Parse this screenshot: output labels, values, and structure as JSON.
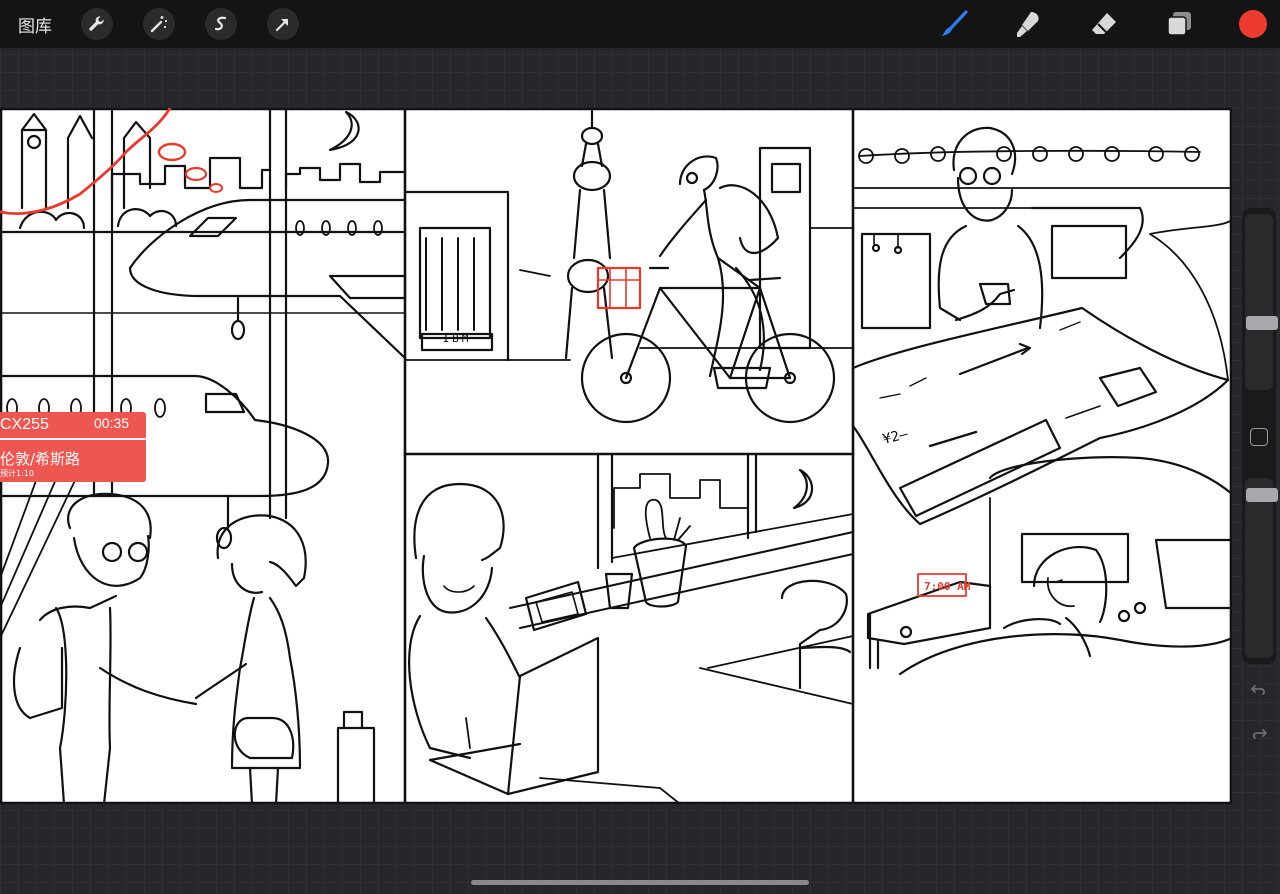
{
  "toolbar": {
    "gallery_label": "图库",
    "left_tools": [
      "wrench-icon",
      "magic-wand-icon",
      "selection-icon",
      "transform-arrow-icon"
    ],
    "right_tools": [
      "brush-icon",
      "smudge-icon",
      "eraser-icon",
      "layers-icon"
    ],
    "active_tool": "brush-icon",
    "current_color": "#ee3b30"
  },
  "artwork": {
    "flight_card": {
      "flight_number": "CX255",
      "time": "00:35",
      "destination": "伦敦/希斯路",
      "subtitle": "预计1:10"
    },
    "building_sign": "IBM",
    "alarm_clock": "7:00 AM",
    "check_mark": "¥2—"
  },
  "sidebar": {
    "brush_size_level": 0.63,
    "opacity_level": 0.06,
    "modify_button": "square-modify-icon",
    "undo": "undo-icon",
    "redo": "redo-icon"
  },
  "colors": {
    "accent_blue": "#2f7cf6",
    "red": "#ee3b30",
    "toolbar": "#141414",
    "canvas_bg": "#26272a"
  }
}
